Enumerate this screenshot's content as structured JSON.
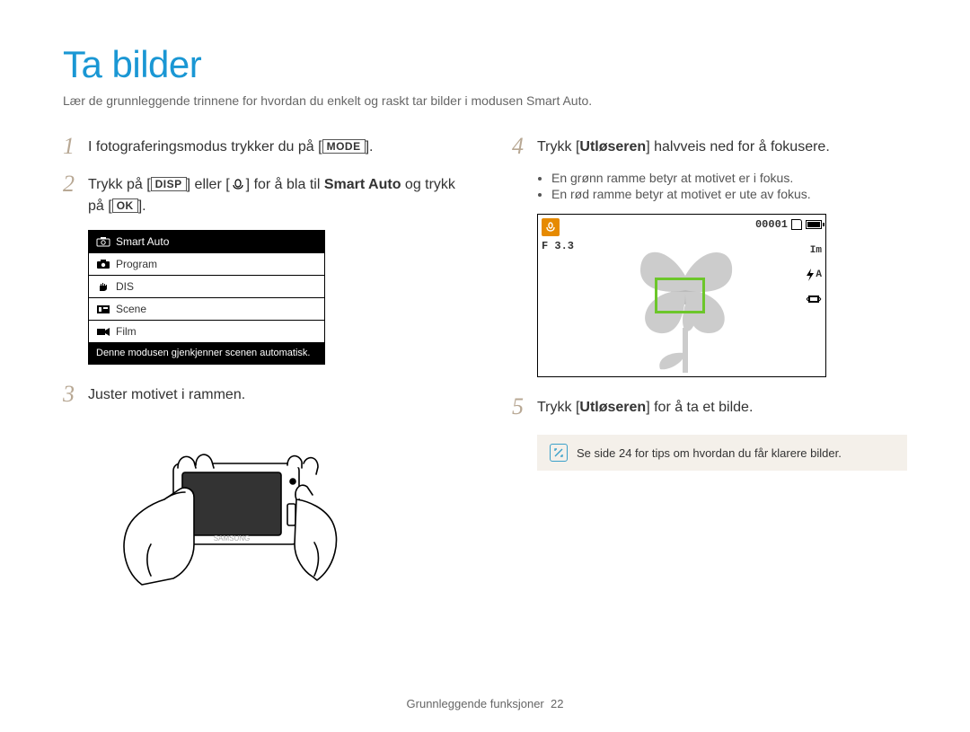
{
  "title": "Ta bilder",
  "intro": "Lær de grunnleggende trinnene for hvordan du enkelt og raskt tar bilder i modusen Smart Auto.",
  "left": {
    "step1": {
      "num": "1",
      "pre": "I fotograferingsmodus trykker du på [",
      "btn": "MODE",
      "post": "]."
    },
    "step2": {
      "num": "2",
      "t1": "Trykk på [",
      "btn1": "DISP",
      "t2": "] eller [",
      "t3": "] for å bla til ",
      "bold": "Smart Auto",
      "t4": " og trykk på [",
      "btn2": "OK",
      "t5": "]."
    },
    "menu": {
      "items": [
        {
          "label": "Smart Auto",
          "selected": true
        },
        {
          "label": "Program",
          "selected": false
        },
        {
          "label": "DIS",
          "selected": false
        },
        {
          "label": "Scene",
          "selected": false
        },
        {
          "label": "Film",
          "selected": false
        }
      ],
      "caption": "Denne modusen gjenkjenner scenen automatisk."
    },
    "step3": {
      "num": "3",
      "text": "Juster motivet i rammen."
    }
  },
  "right": {
    "step4": {
      "num": "4",
      "pre": "Trykk [",
      "bold": "Utløseren",
      "post": "] halvveis ned for å fokusere."
    },
    "bullets": [
      "En grønn ramme betyr at motivet er i fokus.",
      "En rød ramme betyr at motivet er ute av fokus."
    ],
    "preview": {
      "fval": "F 3.3",
      "counter": "00001",
      "size_label": "Im",
      "flash_label": "A"
    },
    "step5": {
      "num": "5",
      "pre": "Trykk [",
      "bold": "Utløseren",
      "post": "] for å ta et bilde."
    },
    "note": "Se side 24 for tips om hvordan du får klarere bilder."
  },
  "footer": {
    "section": "Grunnleggende funksjoner",
    "page": "22"
  }
}
